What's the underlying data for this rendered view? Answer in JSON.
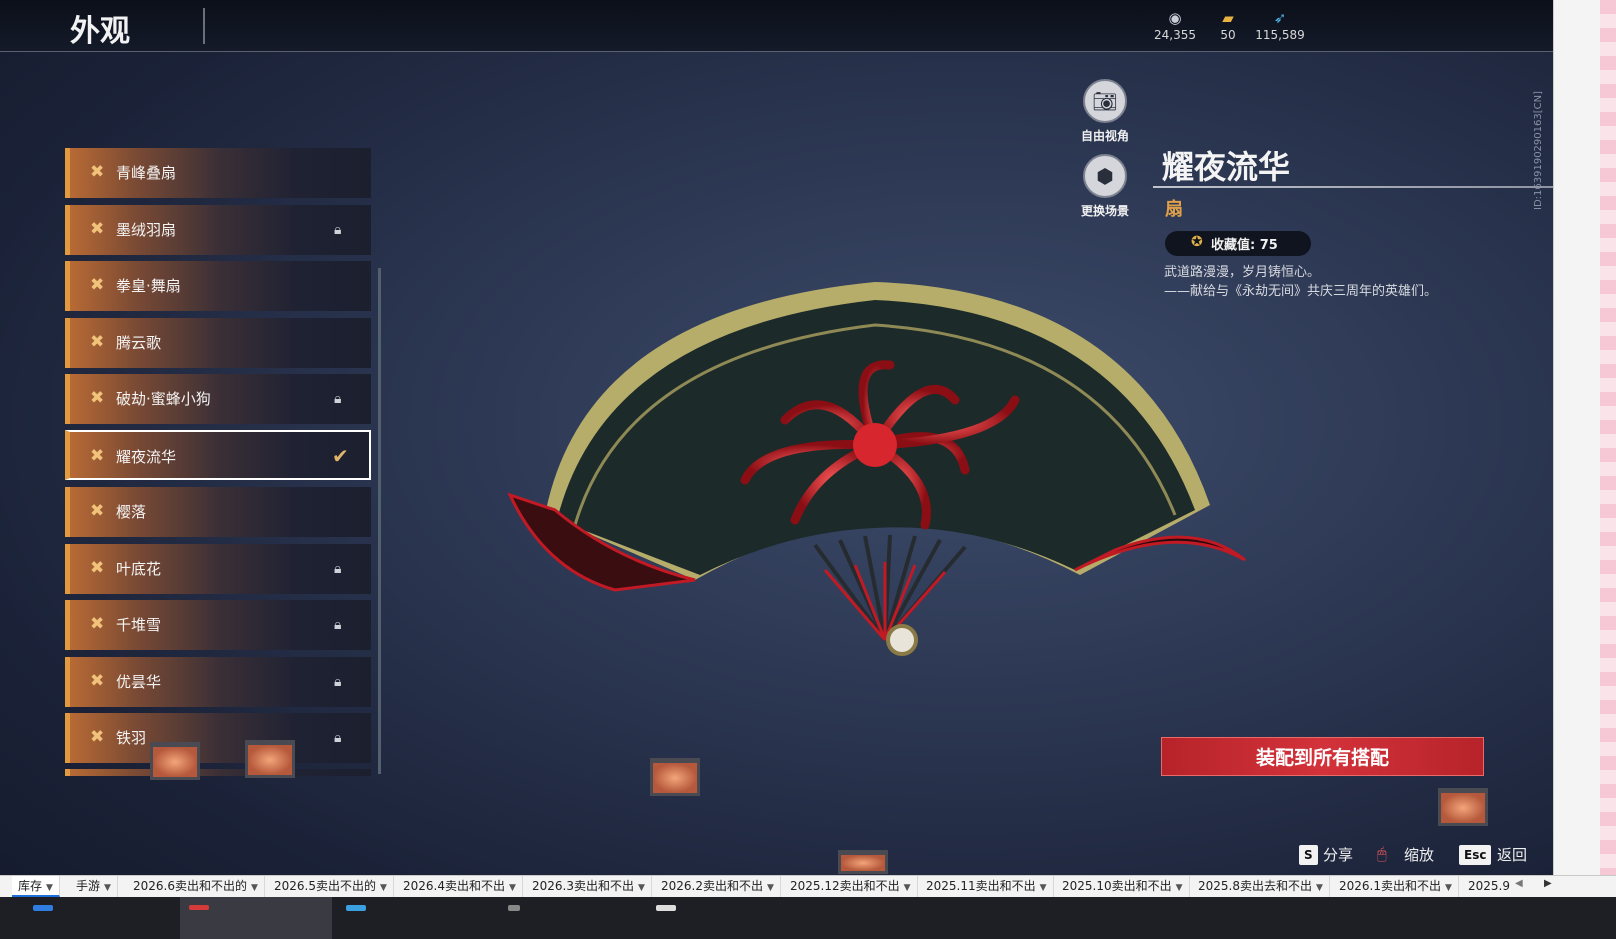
{
  "header": {
    "title": "外观",
    "currencies": [
      {
        "icon": "silver-coin-icon",
        "value": "24,355"
      },
      {
        "icon": "ticket-icon",
        "value": "50"
      },
      {
        "icon": "feather-icon",
        "value": "115,589"
      }
    ]
  },
  "side_id": "ID:1639190290163[CN]",
  "list": {
    "items": [
      {
        "label": "青峰叠扇",
        "locked": false
      },
      {
        "label": "墨绒羽扇",
        "locked": true
      },
      {
        "label": "拳皇·舞扇",
        "locked": false
      },
      {
        "label": "腾云歌",
        "locked": false
      },
      {
        "label": "破劫·蜜蜂小狗",
        "locked": true
      },
      {
        "label": "耀夜流华",
        "locked": false,
        "selected": true
      },
      {
        "label": "樱落",
        "locked": false
      },
      {
        "label": "叶底花",
        "locked": true
      },
      {
        "label": "千堆雪",
        "locked": true
      },
      {
        "label": "优昙华",
        "locked": true
      },
      {
        "label": "铁羽",
        "locked": true
      }
    ]
  },
  "camera": {
    "free_view_label": "自由视角",
    "change_scene_label": "更换场景"
  },
  "detail": {
    "name": "耀夜流华",
    "type": "扇",
    "collection_label": "收藏值: 75",
    "desc_line1": "武道路漫漫，岁月铸恒心。",
    "desc_line2": "——献给与《永劫无间》共庆三周年的英雄们。"
  },
  "equip_button": "装配到所有搭配",
  "hints": {
    "share_key": "S",
    "share_label": "分享",
    "zoom_label": "缩放",
    "back_key": "Esc",
    "back_label": "返回"
  },
  "sheet_tabs": [
    "库存",
    "手游",
    "2026.6卖出和不出的",
    "2026.5卖出不出的",
    "2026.4卖出和不出",
    "2026.3卖出和不出",
    "2026.2卖出和不出",
    "2025.12卖出和不出",
    "2025.11卖出和不出",
    "2025.10卖出和不出",
    "2025.8卖出去和不出",
    "2026.1卖出和不出",
    "2025.9"
  ],
  "colors": {
    "accent_orange": "#e39a3f",
    "equip_red": "#d3323a",
    "type_gold": "#e0a04a"
  }
}
